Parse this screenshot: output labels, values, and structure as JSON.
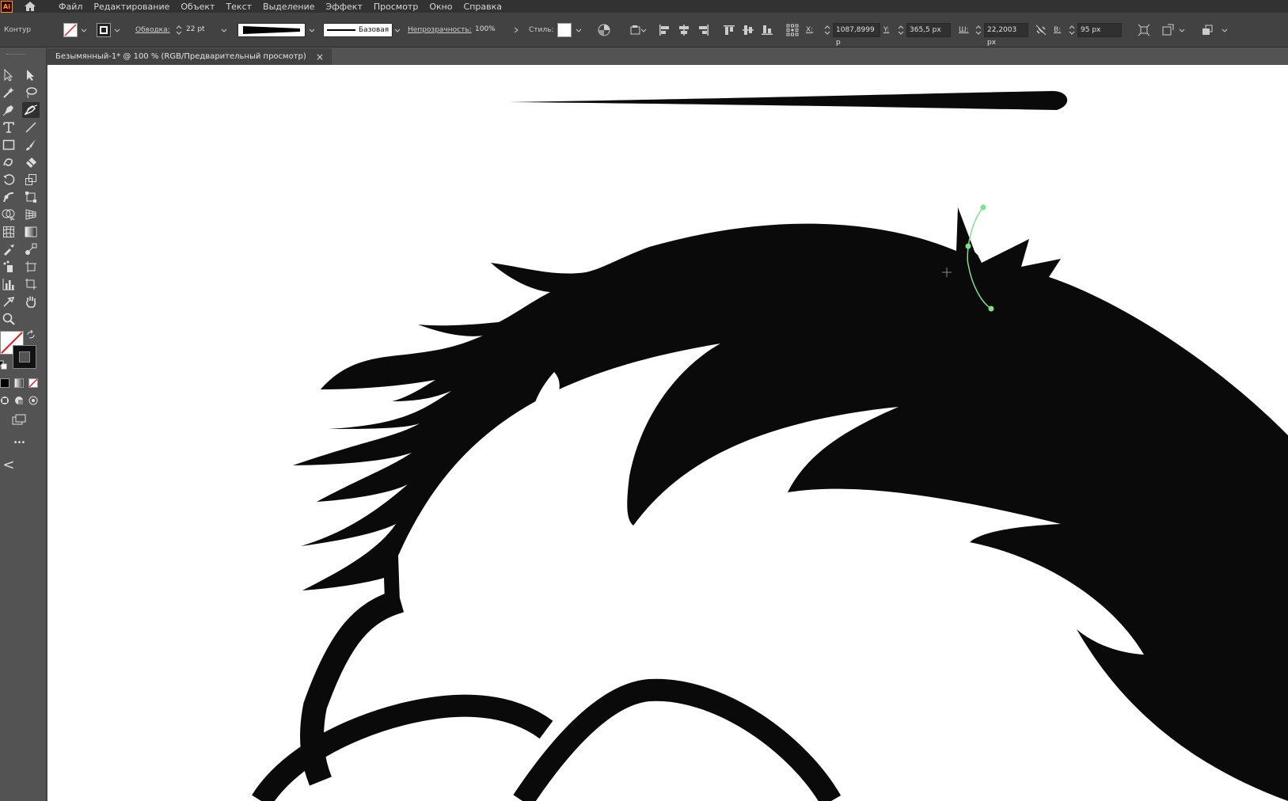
{
  "app": {
    "logo_text": "Ai"
  },
  "menu": {
    "items": [
      "Файл",
      "Редактирование",
      "Объект",
      "Текст",
      "Выделение",
      "Эффект",
      "Просмотр",
      "Окно",
      "Справка"
    ]
  },
  "control": {
    "mode_label": "Контур",
    "stroke_label": "Обводка:",
    "stroke_weight": "22 pt",
    "profile_label": "Базовая",
    "opacity_label": "Непрозрачность:",
    "opacity_value": "100%",
    "style_label": "Стиль:",
    "x_label": "X:",
    "x_value": "1087,8999 p",
    "y_label": "Y:",
    "y_value": "365,5 px",
    "w_label": "Ш:",
    "w_value": "22,2003 px",
    "h_label": "В:",
    "h_value": "95 px"
  },
  "document": {
    "tab_title": "Безымянный-1* @ 100 % (RGB/Предварительный просмотр)",
    "close_glyph": "×"
  },
  "tools": [
    "selection-tool",
    "direct-selection-tool",
    "magic-wand-tool",
    "lasso-tool",
    "pen-tool",
    "curvature-tool",
    "type-tool",
    "line-tool",
    "rectangle-tool",
    "paintbrush-tool",
    "shaper-tool",
    "eraser-tool",
    "rotate-tool",
    "scale-tool",
    "warp-tool",
    "free-transform-tool",
    "shape-builder-tool",
    "perspective-grid-tool",
    "mesh-tool",
    "gradient-tool",
    "eyedropper-tool",
    "blend-tool",
    "symbol-sprayer-tool",
    "artboard-tool",
    "graph-tool",
    "slice-tool",
    "hand-tool",
    "zoom-tool"
  ],
  "colors": {
    "menubar_bg": "#323232",
    "controlbar_bg": "#424242",
    "panel_bg": "#535353",
    "canvas_bg": "#ffffff",
    "art_fill": "#0a0a0a",
    "selection_path": "#7ee08a",
    "app_logo": "#ff9a00"
  },
  "toolbar_extras": {
    "more_glyph": "•••",
    "collapse_glyph": "<"
  }
}
